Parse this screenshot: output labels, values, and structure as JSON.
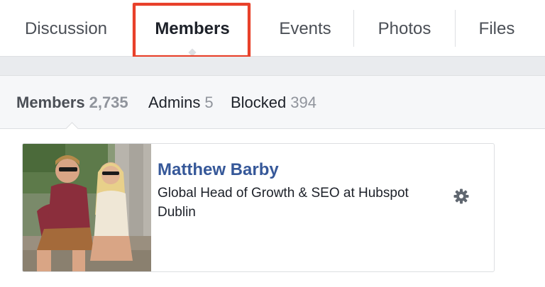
{
  "tabs": {
    "discussion": "Discussion",
    "members": "Members",
    "events": "Events",
    "photos": "Photos",
    "files": "Files"
  },
  "subtabs": {
    "members_label": "Members",
    "members_count": "2,735",
    "admins_label": "Admins",
    "admins_count": "5",
    "blocked_label": "Blocked",
    "blocked_count": "394"
  },
  "member": {
    "name": "Matthew Barby",
    "role": "Global Head of Growth & SEO at Hubspot",
    "location": "Dublin",
    "menu_icon": "gear-icon"
  },
  "colors": {
    "highlight": "#e8402a",
    "link": "#365899",
    "muted": "#90949c"
  }
}
